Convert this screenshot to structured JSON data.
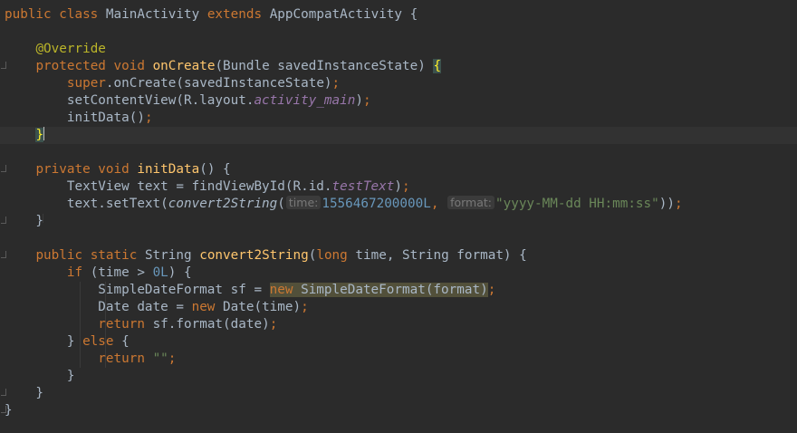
{
  "editor": {
    "lines": [
      {
        "segs": [
          {
            "t": "public class ",
            "c": "kw"
          },
          {
            "t": "MainActivity "
          },
          {
            "t": "extends ",
            "c": "kw"
          },
          {
            "t": "AppCompatActivity {"
          }
        ]
      },
      {
        "segs": []
      },
      {
        "segs": [
          {
            "t": "    "
          },
          {
            "t": "@Override",
            "c": "ann"
          }
        ]
      },
      {
        "segs": [
          {
            "t": "    "
          },
          {
            "t": "protected void ",
            "c": "kw"
          },
          {
            "t": "onCreate",
            "c": "fn"
          },
          {
            "t": "(Bundle savedInstanceState) "
          },
          {
            "t": "{",
            "c": "hl-brace"
          }
        ]
      },
      {
        "segs": [
          {
            "t": "        "
          },
          {
            "t": "super",
            "c": "kw"
          },
          {
            "t": ".onCreate(savedInstanceState)"
          },
          {
            "t": ";",
            "c": "kw"
          }
        ]
      },
      {
        "segs": [
          {
            "t": "        setContentView(R.layout."
          },
          {
            "t": "activity_main",
            "c": "fld"
          },
          {
            "t": ")"
          },
          {
            "t": ";",
            "c": "kw"
          }
        ]
      },
      {
        "segs": [
          {
            "t": "        initData()"
          },
          {
            "t": ";",
            "c": "kw"
          }
        ]
      },
      {
        "current": true,
        "segs": [
          {
            "t": "    "
          },
          {
            "t": "}",
            "c": "hl-brace"
          },
          {
            "caret": true
          }
        ]
      },
      {
        "segs": []
      },
      {
        "segs": [
          {
            "t": "    "
          },
          {
            "t": "private void ",
            "c": "kw"
          },
          {
            "t": "initData",
            "c": "fn"
          },
          {
            "t": "() {"
          }
        ]
      },
      {
        "segs": [
          {
            "t": "        TextView text = findViewById(R.id."
          },
          {
            "t": "testText",
            "c": "fld"
          },
          {
            "t": ")"
          },
          {
            "t": ";",
            "c": "kw"
          }
        ]
      },
      {
        "segs": [
          {
            "t": "        text.setText("
          },
          {
            "t": "convert2String",
            "c": "ital"
          },
          {
            "t": "("
          },
          {
            "hint": "time:"
          },
          {
            "t": "1556467200000L",
            "c": "num"
          },
          {
            "t": ", ",
            "c": "kw"
          },
          {
            "hint": "format:"
          },
          {
            "t": "\"yyyy-MM-dd HH:mm:ss\"",
            "c": "str"
          },
          {
            "t": "))"
          },
          {
            "t": ";",
            "c": "kw"
          }
        ]
      },
      {
        "segs": [
          {
            "t": "    }"
          }
        ]
      },
      {
        "segs": []
      },
      {
        "segs": [
          {
            "t": "    "
          },
          {
            "t": "public static ",
            "c": "kw"
          },
          {
            "t": "String "
          },
          {
            "t": "convert2String",
            "c": "fn"
          },
          {
            "t": "("
          },
          {
            "t": "long ",
            "c": "kw"
          },
          {
            "t": "time, String format) {"
          }
        ]
      },
      {
        "segs": [
          {
            "t": "        "
          },
          {
            "t": "if ",
            "c": "kw"
          },
          {
            "t": "(time > "
          },
          {
            "t": "0L",
            "c": "num"
          },
          {
            "t": ") {"
          }
        ]
      },
      {
        "segs": [
          {
            "t": "            SimpleDateFormat sf = "
          },
          {
            "t": "new SimpleDateFormat(format)",
            "c": "hl-expr",
            "parts": [
              {
                "t": "new ",
                "c": "kw"
              },
              {
                "t": "SimpleDateFormat(format)"
              }
            ]
          },
          {
            "t": ";",
            "c": "kw"
          }
        ]
      },
      {
        "segs": [
          {
            "t": "            Date date = "
          },
          {
            "t": "new ",
            "c": "kw"
          },
          {
            "t": "Date(time)"
          },
          {
            "t": ";",
            "c": "kw"
          }
        ]
      },
      {
        "segs": [
          {
            "t": "            "
          },
          {
            "t": "return ",
            "c": "kw"
          },
          {
            "t": "sf.format(date)"
          },
          {
            "t": ";",
            "c": "kw"
          }
        ]
      },
      {
        "segs": [
          {
            "t": "        } "
          },
          {
            "t": "else ",
            "c": "kw"
          },
          {
            "t": "{"
          }
        ]
      },
      {
        "segs": [
          {
            "t": "            "
          },
          {
            "t": "return ",
            "c": "kw"
          },
          {
            "t": "\"\"",
            "c": "str"
          },
          {
            "t": ";",
            "c": "kw"
          }
        ]
      },
      {
        "segs": [
          {
            "t": "        }"
          }
        ]
      },
      {
        "segs": [
          {
            "t": "    }"
          }
        ]
      },
      {
        "segs": [
          {
            "t": "}"
          }
        ]
      }
    ]
  }
}
